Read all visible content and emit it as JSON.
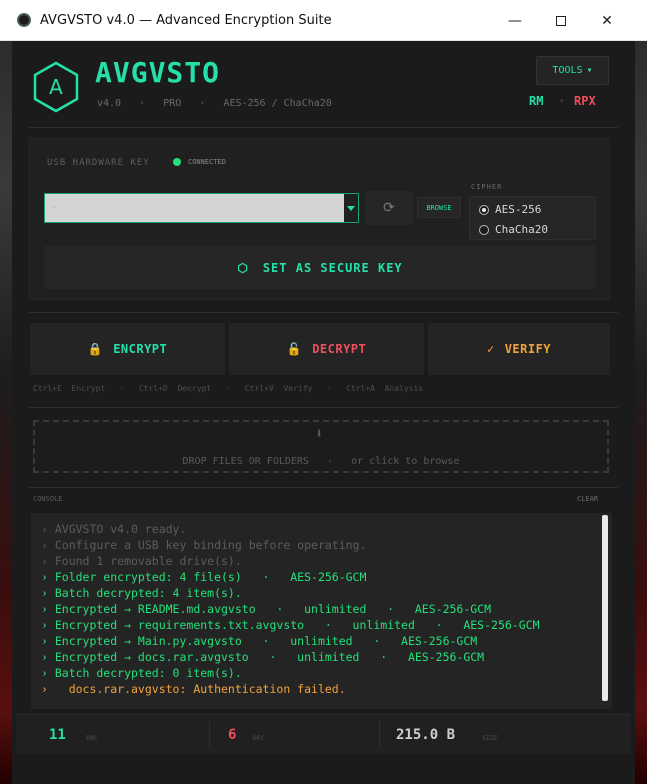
{
  "window": {
    "title": "AVGVSTO v4.0  —  Advanced Encryption Suite",
    "min_glyph": "—",
    "close_glyph": "✕"
  },
  "header": {
    "brand": "AVGVSTO",
    "subline": "v4.0   ·   PRO   ·   AES-256 / ChaCha20",
    "tools_label": "TOOLS",
    "tools_caret": "▾",
    "rm_label": "RM",
    "sep": "·",
    "rpx_label": "RPX",
    "logo_letter": "A"
  },
  "key_panel": {
    "usb_label": "USB HARDWARE KEY",
    "status_text": "CONNECTED",
    "drive_value": "-",
    "refresh_glyph": "⟳",
    "browse_label": "BROWSE",
    "cipher_label": "CIPHER",
    "cipher_options": [
      "AES-256",
      "ChaCha20"
    ],
    "cipher_selected": "AES-256",
    "secure_icon": "⬡",
    "secure_label": "SET AS SECURE KEY"
  },
  "actions": {
    "encrypt_label": "ENCRYPT",
    "encrypt_icon": "🔒",
    "decrypt_label": "DECRYPT",
    "decrypt_icon": "🔓",
    "verify_label": "VERIFY",
    "verify_icon": "✓"
  },
  "shortcuts": "Ctrl+E  Encrypt   ·   Ctrl+D  Decrypt   ·   Ctrl+V  Verify   ·   Ctrl+A  Analysis",
  "dropzone": {
    "icon": "⬇",
    "text": "DROP FILES OR FOLDERS   ·   or click to browse"
  },
  "console": {
    "label": "CONSOLE",
    "clear_label": "CLEAR",
    "lines": [
      {
        "text": "› AVGVSTO v4.0 ready.",
        "style": "dim"
      },
      {
        "text": "› Configure a USB key binding before operating.",
        "style": "dim"
      },
      {
        "text": "› Found 1 removable drive(s).",
        "style": "dim"
      },
      {
        "text": "› Folder encrypted: 4 file(s)   ·   AES-256-GCM",
        "style": "green"
      },
      {
        "text": "› Batch decrypted: 4 item(s).",
        "style": "green"
      },
      {
        "text": "› Encrypted → README.md.avgvsto   ·   unlimited   ·   AES-256-GCM",
        "style": "green"
      },
      {
        "text": "› Encrypted → requirements.txt.avgvsto   ·   unlimited   ·   AES-256-GCM",
        "style": "green"
      },
      {
        "text": "› Encrypted → Main.py.avgvsto   ·   unlimited   ·   AES-256-GCM",
        "style": "green"
      },
      {
        "text": "› Encrypted → docs.rar.avgvsto   ·   unlimited   ·   AES-256-GCM",
        "style": "green"
      },
      {
        "text": "› Batch decrypted: 0 item(s).",
        "style": "green"
      },
      {
        "text": "›   docs.rar.avgvsto: Authentication failed.",
        "style": "orange"
      }
    ]
  },
  "stats": {
    "enc_count": "11",
    "enc_label": "ENC",
    "dec_count": "6",
    "dec_label": "DEC",
    "size_value": "215.0 B",
    "size_label": "SIZE"
  },
  "colors": {
    "accent": "#25e0a8",
    "danger": "#ef4e5e",
    "warning": "#f2a33c",
    "ok": "#25e07a"
  }
}
